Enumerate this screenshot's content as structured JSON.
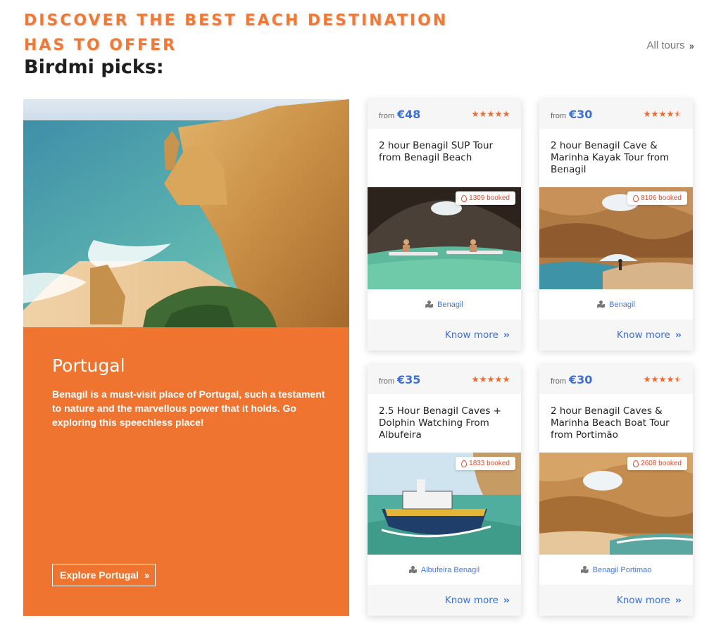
{
  "header": {
    "eyebrow": "DISCOVER THE BEST EACH DESTINATION HAS TO OFFER",
    "title": "Birdmi picks:",
    "all_tours": "All tours"
  },
  "destination": {
    "name": "Portugal",
    "description": "Benagil is a must-visit place of Portugal, such a testament to nature and the marvellous power that it holds. Go exploring this speechless place!",
    "button": "Explore Portugal"
  },
  "tours": [
    {
      "from": "from",
      "price": "€48",
      "rating": 5,
      "title": "2 hour Benagil SUP Tour from Benagil Beach",
      "booked": "1309 booked",
      "location": "Benagil",
      "more": "Know more"
    },
    {
      "from": "from",
      "price": "€30",
      "rating": 4.5,
      "title": "2 hour Benagil Cave & Marinha Kayak Tour from Benagil",
      "booked": "8106 booked",
      "location": "Benagil",
      "more": "Know more"
    },
    {
      "from": "from",
      "price": "€35",
      "rating": 5,
      "title": "2.5 Hour Benagil Caves + Dolphin Watching From Albufeira",
      "booked": "1833 booked",
      "location": "Albufeira Benagil",
      "more": "Know more"
    },
    {
      "from": "from",
      "price": "€30",
      "rating": 4.5,
      "title": "2 hour Benagil Caves & Marinha Beach Boat Tour from Portimão",
      "booked": "2608 booked",
      "location": "Benagil Portimao",
      "more": "Know more"
    }
  ],
  "colors": {
    "accent": "#ef7430",
    "link": "#3b6fd8",
    "star": "#ef6a2c"
  }
}
